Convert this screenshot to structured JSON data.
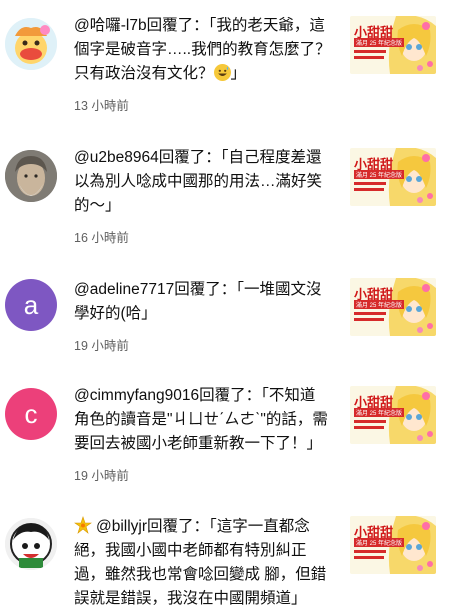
{
  "thumbnail": {
    "title": "小甜甜",
    "band": "滿月 25 年紀念版"
  },
  "notifications": [
    {
      "avatar_type": "cartoon",
      "lines": [
        "@哈囉-l7b回覆了：「我的老天爺，這",
        "個字是破音字…..我們的教育怎麼了？",
        "只有政治沒有文化？"
      ],
      "line3_suffix": "」",
      "emoji": "grinning-sweat-emoji",
      "time": "13 小時前"
    },
    {
      "avatar_type": "photo",
      "lines": [
        "@u2be8964回覆了：「自己程度差還",
        "以為別人唸成中國那的用法…滿好笑",
        "的～」"
      ],
      "time": "16 小時前"
    },
    {
      "avatar_type": "letter",
      "avatar_letter": "a",
      "avatar_color": "#7e57c2",
      "lines": [
        "@adeline7717回覆了：「一堆國文沒",
        "學好的(哈」"
      ],
      "time": "19 小時前"
    },
    {
      "avatar_type": "letter",
      "avatar_letter": "c",
      "avatar_color": "#ec407a",
      "lines": [
        "@cimmyfang9016回覆了：「不知道",
        "角色的讀音是\"ㄐㄩㄝˊㄙㄜˋ\"的話，需",
        "要回去被國小老師重新教一下了！」"
      ],
      "time": "19 小時前"
    },
    {
      "avatar_type": "cartoon2",
      "prefix_icon": "sparkle-icon",
      "lines": [
        "@billyjr回覆了：「這字一直都念",
        "絕，我國小國中老師都有特別糾正",
        "過，雖然我也常會唸回變成 腳，但錯",
        "誤就是錯誤，我沒在中國開頻道」"
      ]
    }
  ]
}
